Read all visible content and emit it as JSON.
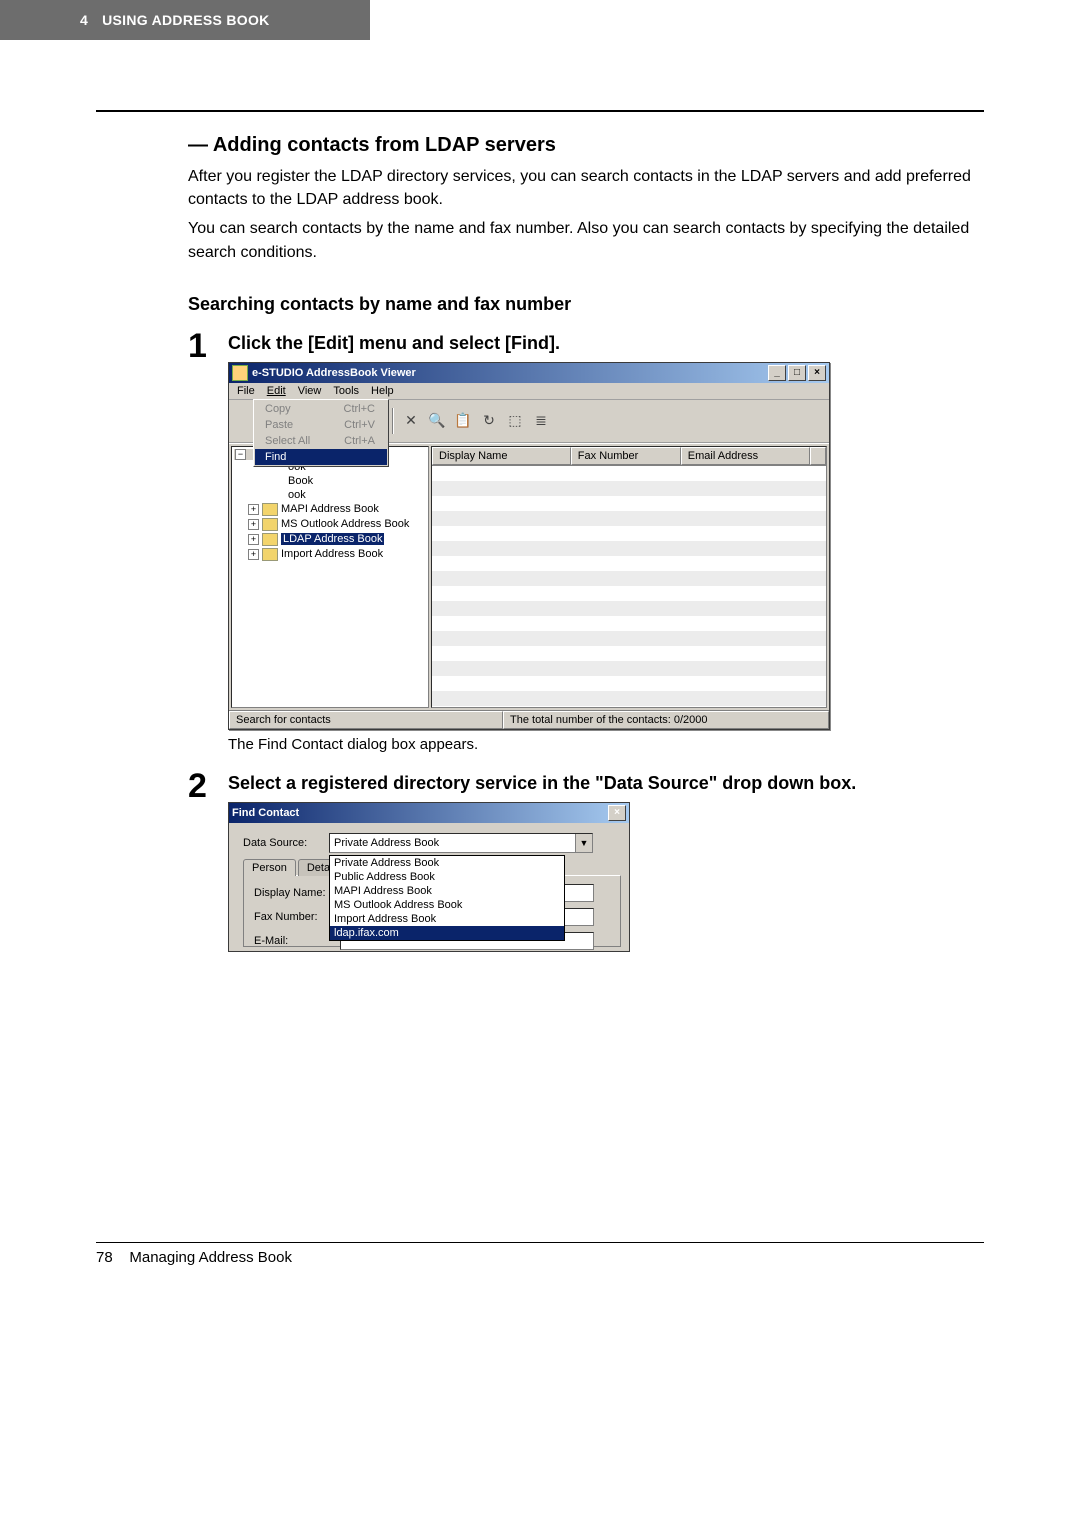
{
  "header": {
    "chapter_num": "4",
    "chapter_title": "USING ADDRESS BOOK"
  },
  "section": {
    "title": "— Adding contacts from LDAP servers",
    "para1": "After you register the LDAP directory services, you can search contacts in the LDAP servers and add preferred contacts to the LDAP address book.",
    "para2": "You can search contacts by the name and fax number. Also you can search contacts by specifying the detailed search conditions.",
    "subheading": "Searching contacts by name and fax number"
  },
  "steps": [
    {
      "num": "1",
      "title": "Click the [Edit] menu and select [Find].",
      "caption": "The Find Contact dialog box appears."
    },
    {
      "num": "2",
      "title": "Select a registered directory service in the \"Data Source\" drop down box.",
      "caption": ""
    }
  ],
  "win1": {
    "title": "e-STUDIO AddressBook Viewer",
    "menus": [
      "File",
      "Edit",
      "View",
      "Tools",
      "Help"
    ],
    "editmenu": [
      {
        "label": "Copy",
        "shortcut": "Ctrl+C",
        "state": "disabled"
      },
      {
        "label": "Paste",
        "shortcut": "Ctrl+V",
        "state": "disabled"
      },
      {
        "label": "Select All",
        "shortcut": "Ctrl+A",
        "state": "disabled"
      },
      {
        "label": "Find",
        "shortcut": "",
        "state": "highlight"
      }
    ],
    "tree_residual": [
      "ook",
      "Book",
      "ook"
    ],
    "tree_items": [
      {
        "label": "MAPI Address Book",
        "sel": false
      },
      {
        "label": "MS Outlook Address Book",
        "sel": false
      },
      {
        "label": "LDAP Address Book",
        "sel": true
      },
      {
        "label": "Import Address Book",
        "sel": false
      }
    ],
    "columns": [
      "Display Name",
      "Fax Number",
      "Email Address"
    ],
    "status_left": "Search for contacts",
    "status_right": "The total number of the contacts: 0/2000"
  },
  "win2": {
    "title": "Find Contact",
    "data_source_label": "Data Source:",
    "data_source_value": "Private Address Book",
    "tabs": [
      "Person",
      "Detail Setting"
    ],
    "dropdown": [
      {
        "label": "Private Address Book",
        "hl": false
      },
      {
        "label": "Public Address Book",
        "hl": false
      },
      {
        "label": "MAPI Address Book",
        "hl": false
      },
      {
        "label": "MS Outlook Address Book",
        "hl": false
      },
      {
        "label": "Import Address Book",
        "hl": false
      },
      {
        "label": "ldap.ifax.com",
        "hl": true
      }
    ],
    "fields": [
      {
        "label": "Display Name:"
      },
      {
        "label": "Fax Number:"
      },
      {
        "label": "E-Mail:"
      }
    ]
  },
  "footer": {
    "page": "78",
    "label": "Managing Address Book"
  }
}
